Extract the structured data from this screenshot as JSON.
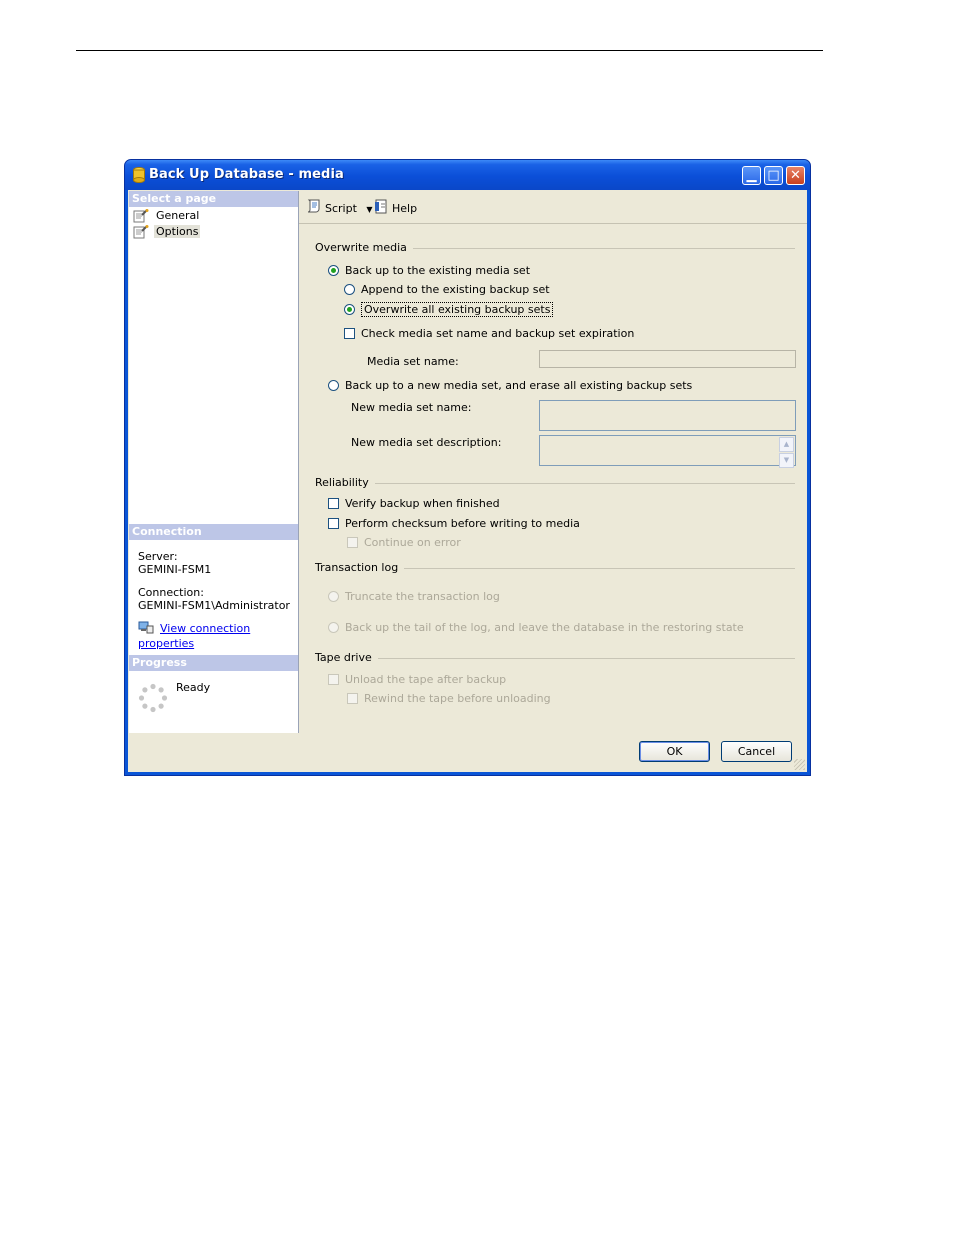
{
  "window": {
    "title": "Back Up Database - media",
    "minimize_label": "▁",
    "maximize_label": "□",
    "close_label": "✕"
  },
  "sidebar": {
    "select_page_header": "Select a page",
    "pages": [
      {
        "label": "General",
        "icon": "page-wrench-icon",
        "selected": false
      },
      {
        "label": "Options",
        "icon": "page-wrench-icon",
        "selected": true
      }
    ],
    "connection_header": "Connection",
    "server_label": "Server:",
    "server_value": "GEMINI-FSM1",
    "connection_label": "Connection:",
    "connection_value": "GEMINI-FSM1\\Administrator",
    "view_connection_link": "View connection properties",
    "progress_header": "Progress",
    "progress_status": "Ready"
  },
  "toolbar": {
    "script_label": "Script",
    "help_label": "Help"
  },
  "overwrite_media": {
    "group_label": "Overwrite media",
    "existing_set_label": "Back up to the existing media set",
    "append_label": "Append to the existing backup set",
    "overwrite_label": "Overwrite all existing backup sets",
    "check_expiration_label": "Check media set name and backup set expiration",
    "media_set_name_label": "Media set name:",
    "media_set_name_value": "",
    "new_set_label": "Back up to a new media set, and erase all existing backup sets",
    "new_media_set_name_label": "New media set name:",
    "new_media_set_name_value": "",
    "new_media_set_description_label": "New media set description:",
    "new_media_set_description_value": ""
  },
  "reliability": {
    "group_label": "Reliability",
    "verify_label": "Verify backup when finished",
    "checksum_label": "Perform checksum before writing to media",
    "continue_on_error_label": "Continue on error"
  },
  "transaction_log": {
    "group_label": "Transaction log",
    "truncate_label": "Truncate the transaction log",
    "tail_label": "Back up the tail of the log, and leave the database in the restoring state"
  },
  "tape_drive": {
    "group_label": "Tape drive",
    "unload_label": "Unload the tape after backup",
    "rewind_label": "Rewind the tape before unloading"
  },
  "buttons": {
    "ok_label": "OK",
    "cancel_label": "Cancel"
  }
}
